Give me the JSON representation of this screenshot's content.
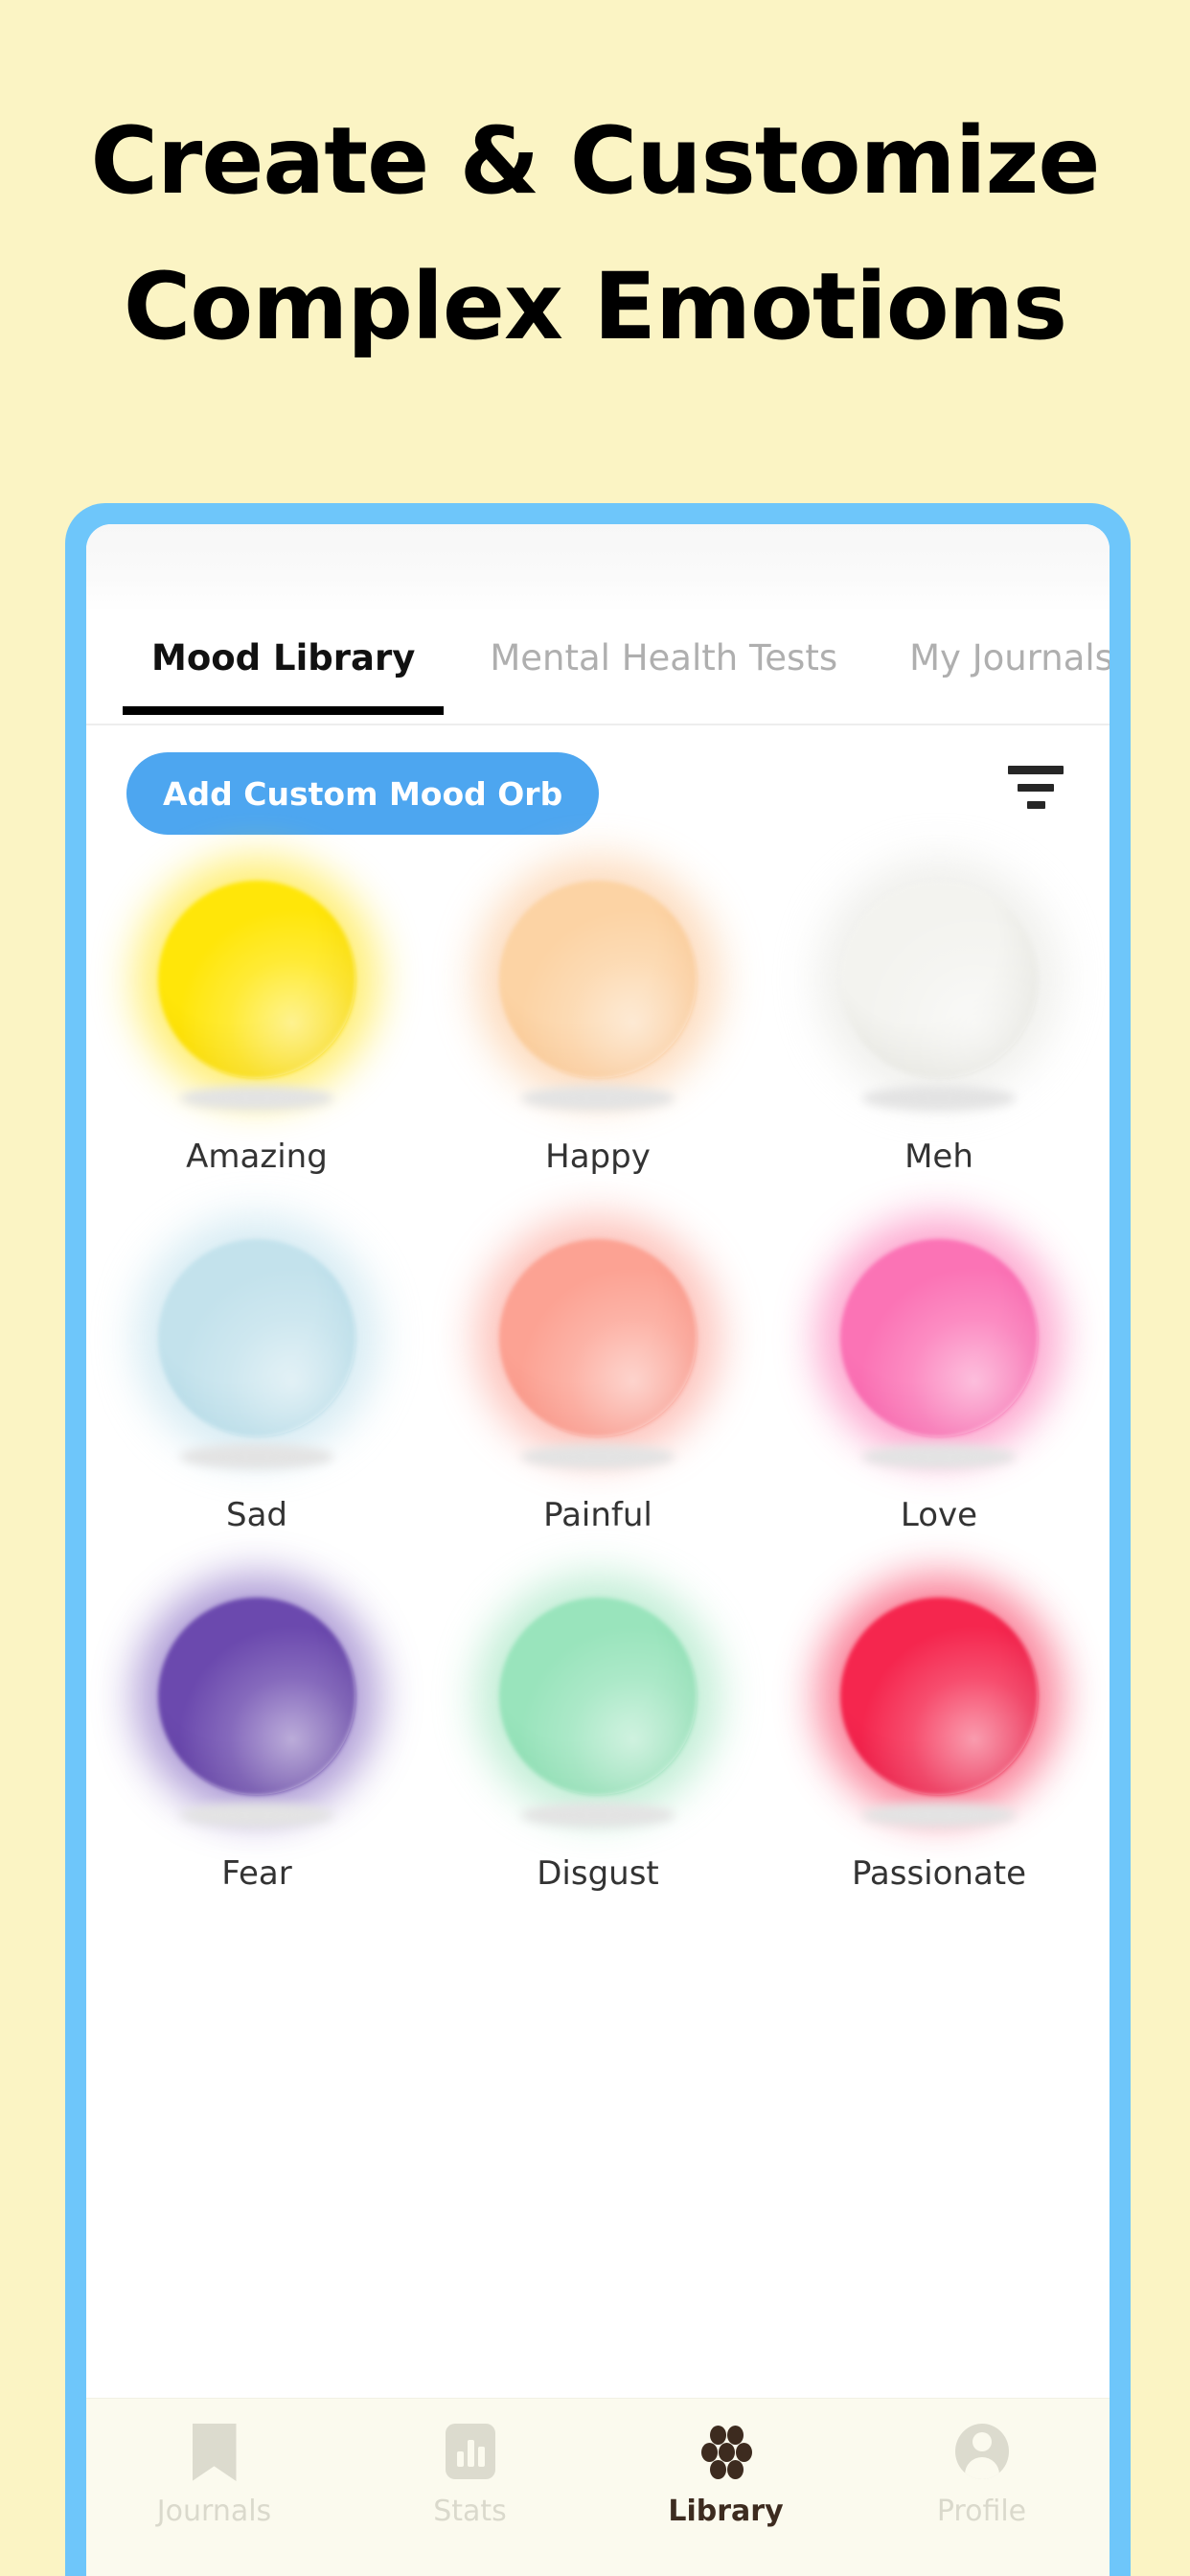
{
  "headline": {
    "line1": "Create & Customize",
    "line2": "Complex Emotions"
  },
  "colors": {
    "page_background": "#FBF4C4",
    "phone_frame": "#6EC6FA",
    "accent_blue": "#4DA6F0",
    "active_tab": "#111111",
    "inactive_tab": "#AFAFAF",
    "nav_background": "#FBFAEE",
    "nav_active": "#3D2B1F",
    "nav_inactive": "#DAD9CC"
  },
  "tabs": [
    {
      "label": "Mood Library",
      "active": true
    },
    {
      "label": "Mental Health Tests",
      "active": false
    },
    {
      "label": "My Journals",
      "active": false
    }
  ],
  "toolbar": {
    "add_button_label": "Add Custom Mood Orb",
    "filter_icon": "filter-icon"
  },
  "orbs": [
    {
      "label": "Amazing",
      "color": "#FFE609",
      "glow": "#FFE100",
      "shade": "#F2CE00"
    },
    {
      "label": "Happy",
      "color": "#FCD3A4",
      "glow": "#FBC08A",
      "shade": "#F7BE88"
    },
    {
      "label": "Meh",
      "color": "#F3F3EF",
      "glow": "#E4E4DE",
      "shade": "#DCDCD5"
    },
    {
      "label": "Sad",
      "color": "#C3E2EC",
      "glow": "#B6DCEA",
      "shade": "#A9D4E2"
    },
    {
      "label": "Painful",
      "color": "#FCA293",
      "glow": "#FB9284",
      "shade": "#F58A7C"
    },
    {
      "label": "Love",
      "color": "#FB73B5",
      "glow": "#FB5FA8",
      "shade": "#F25CA5"
    },
    {
      "label": "Fear",
      "color": "#6B49AE",
      "glow": "#6C4BB5",
      "shade": "#5B3C9B"
    },
    {
      "label": "Disgust",
      "color": "#99E4BC",
      "glow": "#8FE0B4",
      "shade": "#83D6A9"
    },
    {
      "label": "Passionate",
      "color": "#F5264E",
      "glow": "#F61B46",
      "shade": "#E01742"
    }
  ],
  "bottom_nav": [
    {
      "label": "Journals",
      "icon": "bookmark-icon",
      "active": false
    },
    {
      "label": "Stats",
      "icon": "bar-chart-icon",
      "active": false
    },
    {
      "label": "Library",
      "icon": "honeycomb-icon",
      "active": true
    },
    {
      "label": "Profile",
      "icon": "person-icon",
      "active": false
    }
  ]
}
